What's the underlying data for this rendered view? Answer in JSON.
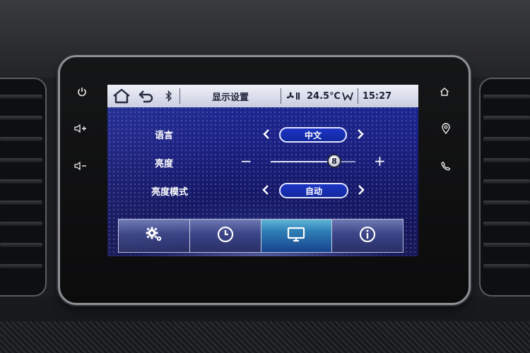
{
  "status_bar": {
    "title": "显示设置",
    "temperature": "24.5℃",
    "time": "15:27",
    "icons": [
      "home-icon",
      "back-icon",
      "bluetooth-icon",
      "fan-icon",
      "air-flow-icon"
    ]
  },
  "settings": {
    "language": {
      "label": "语言",
      "value": "中文"
    },
    "brightness": {
      "label": "亮度",
      "value": "8",
      "level_fraction": 0.75,
      "minus": "−",
      "plus": "+"
    },
    "brightness_mode": {
      "label": "亮度模式",
      "value": "自动"
    }
  },
  "tabs": [
    {
      "name": "settings",
      "icon": "gears-icon",
      "active": false
    },
    {
      "name": "clock",
      "icon": "clock-icon",
      "active": false
    },
    {
      "name": "display",
      "icon": "monitor-icon",
      "active": true
    },
    {
      "name": "info",
      "icon": "info-icon",
      "active": false
    }
  ],
  "bezel_buttons": {
    "left": [
      "power-icon",
      "volume-up-icon",
      "volume-down-icon"
    ],
    "right": [
      "home-icon",
      "navigation-icon",
      "phone-icon"
    ]
  },
  "colors": {
    "accent": "#1c34c4",
    "screen_bg": "#1c2286",
    "status_bar": "#e4e7f2",
    "active_tab": "#2f7fb6"
  }
}
